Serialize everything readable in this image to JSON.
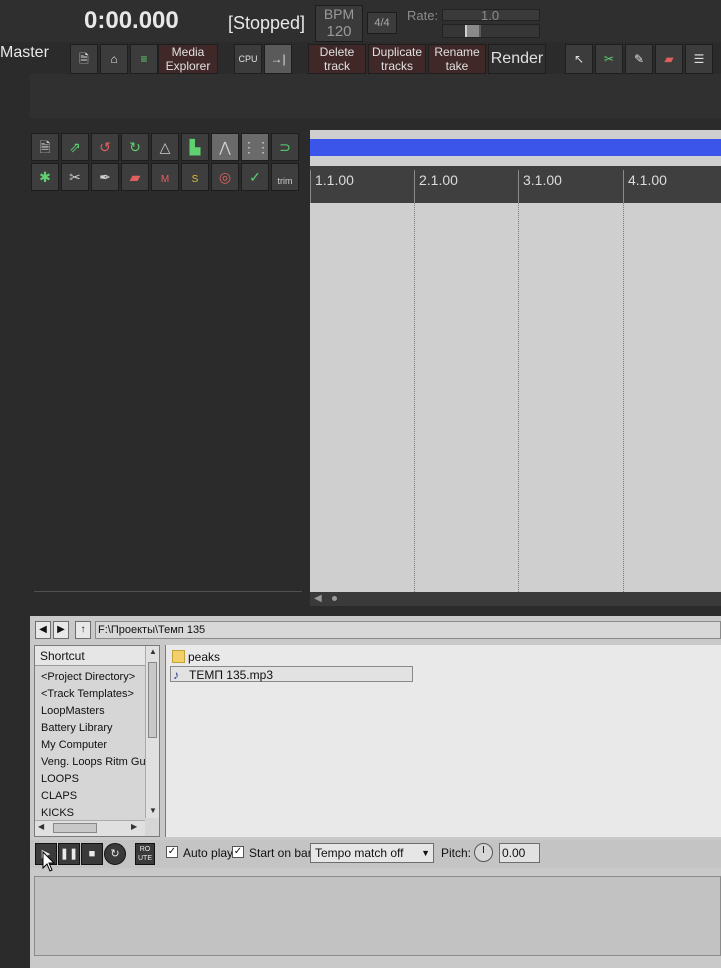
{
  "transport": {
    "time": "0:00.000",
    "state": "[Stopped]",
    "bpm_label": "BPM",
    "bpm_value": "120",
    "time_sig": "4/4",
    "rate_label": "Rate:",
    "rate_value": "1.0"
  },
  "toolbar": {
    "master": "Master",
    "media_explorer": [
      "Media",
      "Explorer"
    ],
    "delete_track": [
      "Delete",
      "track"
    ],
    "duplicate_tracks": [
      "Duplicate",
      "tracks"
    ],
    "rename_take": [
      "Rename",
      "take"
    ],
    "render": "Render"
  },
  "edit_toolbar": {
    "trim_label": "trim"
  },
  "timeline": {
    "markers": [
      "1.1.00",
      "2.1.00",
      "3.1.00",
      "4.1.00"
    ]
  },
  "media_explorer": {
    "path": "F:\\Проекты\\Темп 135",
    "shortcut_header": "Shortcut",
    "shortcuts": [
      "<Project Directory>",
      "<Track Templates>",
      "LoopMasters",
      "Battery Library",
      "My Computer",
      "Veng. Loops Ritm Gu",
      "LOOPS",
      "CLAPS",
      "KICKS"
    ],
    "files": [
      {
        "name": "peaks",
        "type": "folder"
      },
      {
        "name": "ТЕМП 135.mp3",
        "type": "audio"
      }
    ],
    "auto_play_label": "Auto play",
    "start_on_bar_label": "Start on bar",
    "tempo_match": "Tempo match off",
    "pitch_label": "Pitch:",
    "pitch_value": "0.00",
    "route_label": "RO UTE",
    "auto_play_checked": true,
    "start_on_bar_checked": true
  }
}
